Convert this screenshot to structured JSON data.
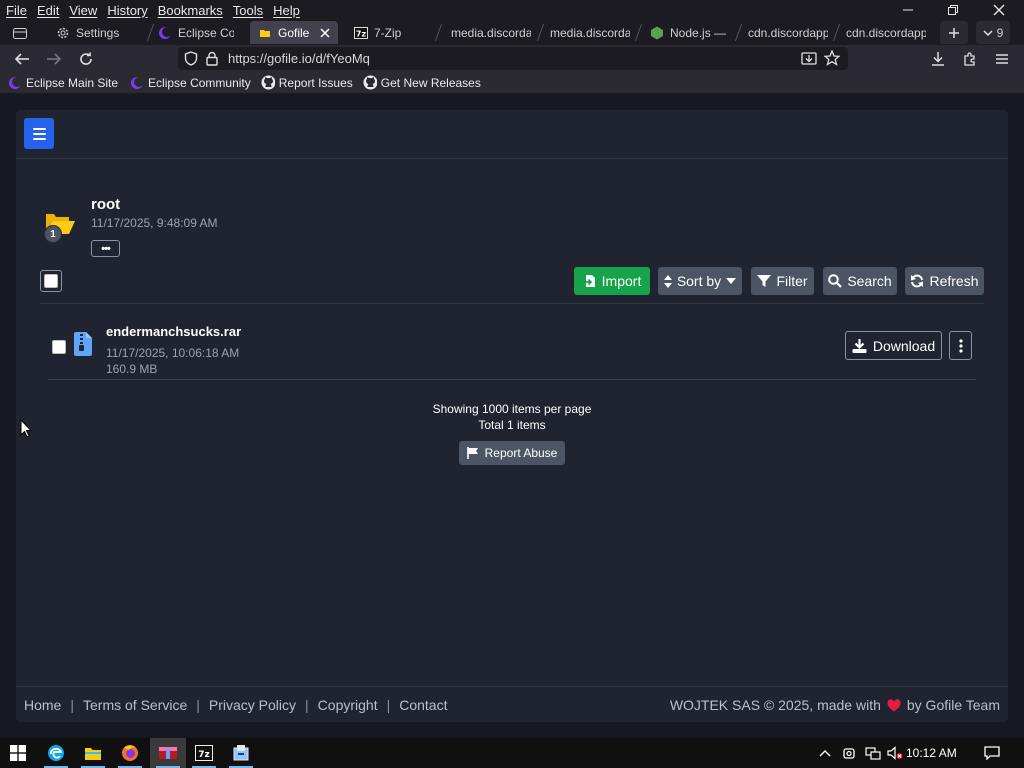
{
  "menubar": {
    "items": [
      "File",
      "Edit",
      "View",
      "History",
      "Bookmarks",
      "Tools",
      "Help"
    ]
  },
  "window_controls": [
    "minimize",
    "restore",
    "close"
  ],
  "tabs": [
    {
      "label": "Settings",
      "icon": "gear-icon"
    },
    {
      "label": "Eclipse Cor",
      "icon": "eclipse-icon"
    },
    {
      "label": "Gofile -",
      "icon": "gofile-icon",
      "active": true
    },
    {
      "label": "7-Zip",
      "icon": "7zip-icon"
    },
    {
      "label": "media.discorda",
      "icon": "none"
    },
    {
      "label": "media.discorda",
      "icon": "none"
    },
    {
      "label": "Node.js —",
      "icon": "nodejs-icon"
    },
    {
      "label": "cdn.discordapp",
      "icon": "none"
    },
    {
      "label": "cdn.discordapp",
      "icon": "none"
    }
  ],
  "tab_overflow_count": "9",
  "url": "https://gofile.io/d/fYeoMq",
  "bookmarks": [
    {
      "label": "Eclipse Main Site",
      "icon": "eclipse-icon"
    },
    {
      "label": "Eclipse Community",
      "icon": "eclipse-icon"
    },
    {
      "label": "Report Issues",
      "icon": "github-icon"
    },
    {
      "label": "Get New Releases",
      "icon": "github-icon"
    }
  ],
  "folder": {
    "name": "root",
    "date": "11/17/2025, 9:48:09 AM",
    "badge": "1",
    "more_label": "•••"
  },
  "toolbar": {
    "import": "Import",
    "sort": "Sort by",
    "filter": "Filter",
    "search": "Search",
    "refresh": "Refresh"
  },
  "files": [
    {
      "name": "endermanchsucks.rar",
      "date": "11/17/2025, 10:06:18 AM",
      "size": "160.9 MB",
      "download": "Download"
    }
  ],
  "pagination": {
    "showing": "Showing 1000 items per page",
    "total": "Total 1 items"
  },
  "report_abuse": "Report Abuse",
  "footer": {
    "links": [
      "Home",
      "Terms of Service",
      "Privacy Policy",
      "Copyright",
      "Contact"
    ],
    "separator": "|",
    "credit_prefix": "WOJTEK SAS © 2025, made with",
    "credit_suffix": "by Gofile Team"
  },
  "taskbar": {
    "time": "10:12 AM",
    "apps": [
      "start-icon",
      "edge-icon",
      "explorer-icon",
      "firefox-icon",
      "winrar-icon",
      "7zip-icon",
      "installer-icon"
    ]
  },
  "colors": {
    "accent_blue": "#2563eb",
    "import_green": "#16a34a",
    "heart_red": "#e11d48"
  }
}
